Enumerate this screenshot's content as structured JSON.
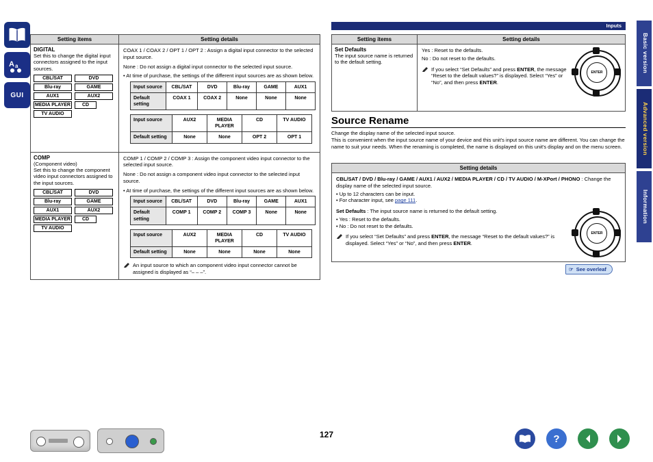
{
  "page": {
    "number": "127",
    "header_label": "Inputs"
  },
  "right_tabs": [
    {
      "label": "Basic version"
    },
    {
      "label": "Advanced version"
    },
    {
      "label": "Information"
    }
  ],
  "rail_icons": [
    {
      "name": "book-icon"
    },
    {
      "name": "font-size-icon"
    },
    {
      "name": "gui-icon",
      "label": "GUI"
    }
  ],
  "left_table": {
    "headers": {
      "items": "Setting items",
      "details": "Setting details"
    },
    "rows": [
      {
        "title": "DIGITAL",
        "desc": "Set this to change the digital input connectors assigned to the input sources.",
        "chips": [
          "CBL/SAT",
          "DVD",
          "Blu-ray",
          "GAME",
          "AUX1",
          "AUX2",
          "MEDIA PLAYER",
          "CD",
          "TV AUDIO"
        ],
        "detail_lines": [
          "COAX 1 / COAX 2 / OPT 1 / OPT 2 : Assign a digital input connector to the selected input source.",
          "None : Do not assign a digital input connector to the selected input source.",
          "At time of purchase, the settings of the different input sources are as shown below."
        ],
        "grids": [
          {
            "head_label": "Input source",
            "head_cells": [
              "CBL/SAT",
              "DVD",
              "Blu-ray",
              "GAME",
              "AUX1"
            ],
            "row_label": "Default setting",
            "row_cells": [
              "COAX 1",
              "COAX 2",
              "None",
              "None",
              "None"
            ]
          },
          {
            "head_label": "Input source",
            "head_cells": [
              "AUX2",
              "MEDIA PLAYER",
              "CD",
              "TV AUDIO"
            ],
            "row_label": "Default setting",
            "row_cells": [
              "None",
              "None",
              "OPT 2",
              "OPT 1"
            ]
          }
        ]
      },
      {
        "title": "COMP",
        "subtitle": "(Component video)",
        "desc": "Set this to change the component video input connectors assigned to the input sources.",
        "chips": [
          "CBL/SAT",
          "DVD",
          "Blu-ray",
          "GAME",
          "AUX1",
          "AUX2",
          "MEDIA PLAYER",
          "CD",
          "TV AUDIO"
        ],
        "detail_lines": [
          "COMP 1 / COMP 2 / COMP 3 : Assign the component video input connector to the selected input source.",
          "None : Do not assign a component video input connector to the selected input source.",
          "At time of purchase, the settings of the different input sources are as shown below."
        ],
        "grids": [
          {
            "head_label": "Input source",
            "head_cells": [
              "CBL/SAT",
              "DVD",
              "Blu-ray",
              "GAME",
              "AUX1"
            ],
            "row_label": "Default setting",
            "row_cells": [
              "COMP 1",
              "COMP 2",
              "COMP 3",
              "None",
              "None"
            ]
          },
          {
            "head_label": "Input source",
            "head_cells": [
              "AUX2",
              "MEDIA PLAYER",
              "CD",
              "TV AUDIO"
            ],
            "row_label": "Default setting",
            "row_cells": [
              "None",
              "None",
              "None",
              "None"
            ]
          }
        ],
        "note": "An input source to which an component video input connector cannot be assigned is displayed as “– – –”."
      }
    ]
  },
  "right_table": {
    "headers": {
      "items": "Setting items",
      "details": "Setting details"
    },
    "row": {
      "title": "Set Defaults",
      "desc": "The input source name is returned to the default setting.",
      "yes": "Yes : Reset to the defaults.",
      "no": "No : Do not reset to the defaults.",
      "note_1": "If you select “Set Defaults” and press ",
      "note_enter1": "ENTER",
      "note_2": ", the message “Reset to the default values?” is displayed. Select “Yes” or “No”, and then press ",
      "note_enter2": "ENTER",
      "note_3": "."
    }
  },
  "source_rename": {
    "title": "Source Rename",
    "body_1": "Change the display name of the selected input source.",
    "body_2": "This is convenient when the input source name of your device and this unit's input source name are different. You can change the name to suit your needs. When the renaming is completed, the name is displayed on this unit's display and on the menu screen.",
    "details_header": "Setting details",
    "sources_line": "CBL/SAT / DVD / Blu-ray / GAME / AUX1 / AUX2 / MEDIA PLAYER / CD / TV AUDIO / M-XPort / PHONO",
    "sources_suffix": " : Change the display name of the selected input source.",
    "bullet_1": "Up to 12 characters can be input.",
    "bullet_2_pre": "For character input, see ",
    "bullet_2_link": "page 111",
    "bullet_2_post": ".",
    "set_defaults_label": "Set Defaults",
    "set_defaults_desc": " : The input source name is returned to the default setting.",
    "yes": "Yes : Reset to the defaults.",
    "no": "No : Do not reset to the defaults.",
    "note_1": "If you select “Set Defaults” and press ",
    "note_enter1": "ENTER",
    "note_2": ", the message “Reset to the default values?” is displayed. Select “Yes” or “No”, and then press ",
    "note_enter2": "ENTER",
    "note_3": "."
  },
  "overleaf": {
    "label": "See overleaf"
  },
  "remote": {
    "enter_label": "ENTER"
  }
}
